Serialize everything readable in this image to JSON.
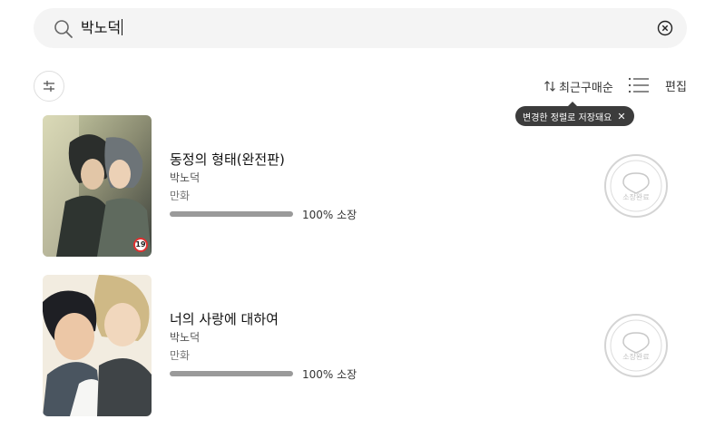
{
  "search": {
    "query": "박노덕"
  },
  "toolbar": {
    "sort_label": "최근구매순",
    "edit_label": "편집",
    "tooltip_text": "변경한 정렬로 저장돼요"
  },
  "books": [
    {
      "title": "동정의 형태(완전판)",
      "author": "박노덕",
      "genre": "만화",
      "progress_percent": 100,
      "progress_label": "100% 소장",
      "age_rating": "19",
      "stamp_label": "소장완료"
    },
    {
      "title": "너의 사랑에 대하여",
      "author": "박노덕",
      "genre": "만화",
      "progress_percent": 100,
      "progress_label": "100% 소장",
      "stamp_label": "소장완료"
    }
  ],
  "colors": {
    "tooltip_bg": "#3c3c3c",
    "progress": "#9a9a9a",
    "age_badge_border": "#e03030"
  },
  "icons": [
    "search-icon",
    "clear-icon",
    "filter-icon",
    "sort-icon",
    "list-view-icon",
    "close-icon",
    "stamp-icon"
  ]
}
